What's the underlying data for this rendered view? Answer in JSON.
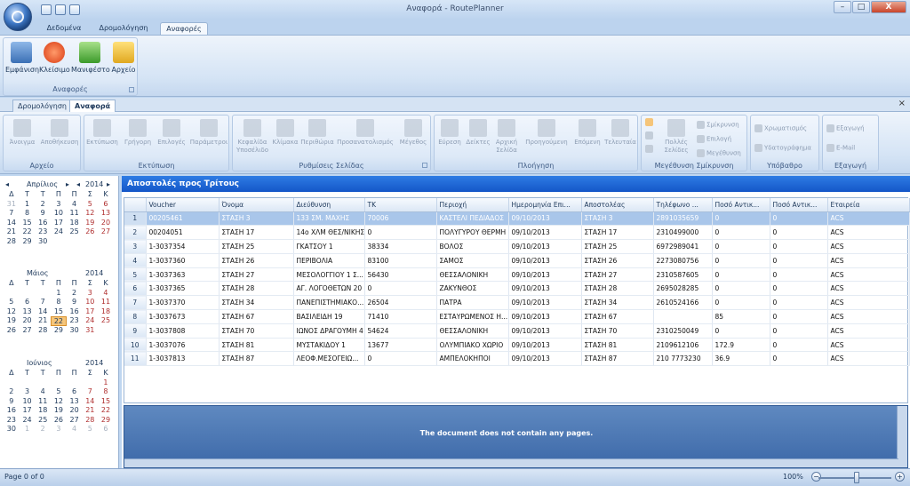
{
  "window": {
    "title": "Αναφορά - RoutePlanner",
    "controls": {
      "minimize": "–",
      "maximize": "□",
      "close": "X"
    }
  },
  "ribbon_tabs": [
    "Δεδομένα",
    "Δρομολόγηση",
    "Αναφορές"
  ],
  "reports_group": {
    "label": "Αναφορές",
    "buttons": [
      "Εμφάνιση",
      "Κλείσιμο",
      "Μανιφέστο",
      "Αρχείο"
    ]
  },
  "doc_tabs": [
    "Δρομολόγηση",
    "Αναφορά"
  ],
  "print_ribbon": {
    "groups": [
      {
        "label": "Αρχείο",
        "buttons": [
          "Άνοιγμα",
          "Αποθήκευση"
        ]
      },
      {
        "label": "Εκτύπωση",
        "buttons": [
          "Εκτύπωση",
          "Γρήγορη",
          "Επιλογές",
          "Παράμετροι"
        ]
      },
      {
        "label": "Ρυθμίσεις Σελίδας",
        "buttons": [
          "Κεφαλίδα Υποσέλιδο",
          "Κλίμακα",
          "Περιθώρια",
          "Προσανατολισμός",
          "Μέγεθος"
        ]
      },
      {
        "label": "Πλοήγηση",
        "buttons": [
          "Εύρεση",
          "Δείκτες",
          "Αρχική Σελίδα",
          "Προηγούμενη",
          "Επόμενη",
          "Τελευταία"
        ]
      },
      {
        "label": "Μεγέθυνση Σμίκρυνση",
        "buttons": [
          "Πολλές Σελίδες"
        ],
        "small": [
          "Σμίκρυνση",
          "Επιλογή",
          "Μεγέθυνση"
        ]
      },
      {
        "label": "Υπόβαθρο",
        "small": [
          "Χρωματισμός",
          "Υδατογράφημα"
        ]
      },
      {
        "label": "Εξαγωγή",
        "small": [
          "Εξαγωγή",
          "E-Mail"
        ]
      }
    ]
  },
  "calendar": {
    "dow": [
      "Δ",
      "Τ",
      "Τ",
      "Π",
      "Π",
      "Σ",
      "Κ"
    ],
    "months": [
      {
        "name": "Απρίλιος",
        "year": "2014",
        "days": [
          [
            "31",
            "dim"
          ],
          [
            "1",
            ""
          ],
          [
            "2",
            ""
          ],
          [
            "3",
            ""
          ],
          [
            "4",
            ""
          ],
          [
            "5",
            "wk"
          ],
          [
            "6",
            "wk"
          ],
          [
            "7",
            ""
          ],
          [
            "8",
            ""
          ],
          [
            "9",
            ""
          ],
          [
            "10",
            ""
          ],
          [
            "11",
            ""
          ],
          [
            "12",
            "wk"
          ],
          [
            "13",
            "wk"
          ],
          [
            "14",
            ""
          ],
          [
            "15",
            ""
          ],
          [
            "16",
            ""
          ],
          [
            "17",
            ""
          ],
          [
            "18",
            ""
          ],
          [
            "19",
            "wk"
          ],
          [
            "20",
            "wk"
          ],
          [
            "21",
            ""
          ],
          [
            "22",
            ""
          ],
          [
            "23",
            ""
          ],
          [
            "24",
            ""
          ],
          [
            "25",
            ""
          ],
          [
            "26",
            "wk"
          ],
          [
            "27",
            "wk"
          ],
          [
            "28",
            ""
          ],
          [
            "29",
            ""
          ],
          [
            "30",
            ""
          ]
        ]
      },
      {
        "name": "Μάιος",
        "year": "2014",
        "days": [
          [
            "",
            ""
          ],
          [
            "",
            ""
          ],
          [
            "",
            ""
          ],
          [
            "1",
            ""
          ],
          [
            "2",
            ""
          ],
          [
            "3",
            "wk"
          ],
          [
            "4",
            "wk"
          ],
          [
            "5",
            ""
          ],
          [
            "6",
            ""
          ],
          [
            "7",
            ""
          ],
          [
            "8",
            ""
          ],
          [
            "9",
            ""
          ],
          [
            "10",
            "wk"
          ],
          [
            "11",
            "wk"
          ],
          [
            "12",
            ""
          ],
          [
            "13",
            ""
          ],
          [
            "14",
            ""
          ],
          [
            "15",
            ""
          ],
          [
            "16",
            ""
          ],
          [
            "17",
            "wk"
          ],
          [
            "18",
            "wk"
          ],
          [
            "19",
            ""
          ],
          [
            "20",
            ""
          ],
          [
            "21",
            ""
          ],
          [
            "22",
            "today"
          ],
          [
            "23",
            ""
          ],
          [
            "24",
            "wk"
          ],
          [
            "25",
            "wk"
          ],
          [
            "26",
            ""
          ],
          [
            "27",
            ""
          ],
          [
            "28",
            ""
          ],
          [
            "29",
            ""
          ],
          [
            "30",
            ""
          ],
          [
            "31",
            "wk"
          ]
        ]
      },
      {
        "name": "Ιούνιος",
        "year": "2014",
        "days": [
          [
            "",
            ""
          ],
          [
            "",
            ""
          ],
          [
            "",
            ""
          ],
          [
            "",
            ""
          ],
          [
            "",
            ""
          ],
          [
            "",
            ""
          ],
          [
            "1",
            "wk"
          ],
          [
            "2",
            ""
          ],
          [
            "3",
            ""
          ],
          [
            "4",
            ""
          ],
          [
            "5",
            ""
          ],
          [
            "6",
            ""
          ],
          [
            "7",
            "wk"
          ],
          [
            "8",
            "wk"
          ],
          [
            "9",
            ""
          ],
          [
            "10",
            ""
          ],
          [
            "11",
            ""
          ],
          [
            "12",
            ""
          ],
          [
            "13",
            ""
          ],
          [
            "14",
            "wk"
          ],
          [
            "15",
            "wk"
          ],
          [
            "16",
            ""
          ],
          [
            "17",
            ""
          ],
          [
            "18",
            ""
          ],
          [
            "19",
            ""
          ],
          [
            "20",
            ""
          ],
          [
            "21",
            "wk"
          ],
          [
            "22",
            "wk"
          ],
          [
            "23",
            ""
          ],
          [
            "24",
            ""
          ],
          [
            "25",
            ""
          ],
          [
            "26",
            ""
          ],
          [
            "27",
            ""
          ],
          [
            "28",
            "wk"
          ],
          [
            "29",
            "wk"
          ],
          [
            "30",
            ""
          ],
          [
            "1",
            "dim"
          ],
          [
            "2",
            "dim"
          ],
          [
            "3",
            "dim"
          ],
          [
            "4",
            "dim"
          ],
          [
            "5",
            "dim"
          ],
          [
            "6",
            "dim"
          ]
        ]
      }
    ]
  },
  "grid": {
    "title": "Αποστολές προς Τρίτους",
    "columns": [
      "Voucher",
      "Όνομα",
      "Διεύθυνση",
      "ΤΚ",
      "Περιοχή",
      "Ημερομηνία Επι...",
      "Αποστολέας",
      "Τηλέφωνο ...",
      "Ποσό Αντικ...",
      "Ποσό Αντικ...",
      "Εταιρεία"
    ],
    "rows": [
      [
        "1",
        "00205461",
        "ΣΤΑΣΗ 3",
        "133 ΣΜ. ΜΑΧΗΣ",
        "70006",
        "ΚΑΣΤΕΛΙ ΠΕΔΙΑΔΟΣ",
        "09/10/2013",
        "ΣΤΑΣΗ 3",
        "2891035659",
        "0",
        "0",
        "ACS"
      ],
      [
        "2",
        "00204051",
        "ΣΤΑΣΗ 17",
        "14ο ΧΛΜ ΘΕΣ/ΝΙΚΗΣ",
        "0",
        "ΠΟΛΥΓΥΡΟΥ ΘΕΡΜΗ",
        "09/10/2013",
        "ΣΤΑΣΗ 17",
        "2310499000",
        "0",
        "0",
        "ACS"
      ],
      [
        "3",
        "1-3037354",
        "ΣΤΑΣΗ 25",
        "ΓΚΑΤΣΟΥ 1",
        "38334",
        "ΒΟΛΟΣ",
        "09/10/2013",
        "ΣΤΑΣΗ 25",
        "6972989041",
        "0",
        "0",
        "ACS"
      ],
      [
        "4",
        "1-3037360",
        "ΣΤΑΣΗ 26",
        "ΠΕΡΙΒΟΛΙΑ",
        "83100",
        "ΣΑΜΟΣ",
        "09/10/2013",
        "ΣΤΑΣΗ 26",
        "2273080756",
        "0",
        "0",
        "ACS"
      ],
      [
        "5",
        "1-3037363",
        "ΣΤΑΣΗ 27",
        "ΜΕΣΟΛΟΓΓΙΟΥ 1 Σ...",
        "56430",
        "ΘΕΣΣΑΛΟΝΙΚΗ",
        "09/10/2013",
        "ΣΤΑΣΗ 27",
        "2310587605",
        "0",
        "0",
        "ACS"
      ],
      [
        "6",
        "1-3037365",
        "ΣΤΑΣΗ 28",
        "ΑΓ. ΛΟΓΟΘΕΤΩΝ 20",
        "0",
        "ΖΑΚΥΝΘΟΣ",
        "09/10/2013",
        "ΣΤΑΣΗ 28",
        "2695028285",
        "0",
        "0",
        "ACS"
      ],
      [
        "7",
        "1-3037370",
        "ΣΤΑΣΗ 34",
        "ΠΑΝΕΠΙΣΤΗΜΙΑΚΟ...",
        "26504",
        "ΠΑΤΡΑ",
        "09/10/2013",
        "ΣΤΑΣΗ 34",
        "2610524166",
        "0",
        "0",
        "ACS"
      ],
      [
        "8",
        "1-3037673",
        "ΣΤΑΣΗ 67",
        "ΒΑΣΙΛΕΙΔΗ 19",
        "71410",
        "ΕΣΤΑΥΡΩΜΕΝΟΣ Η...",
        "09/10/2013",
        "ΣΤΑΣΗ 67",
        "",
        "85",
        "0",
        "ACS"
      ],
      [
        "9",
        "1-3037808",
        "ΣΤΑΣΗ 70",
        "ΙΩΝΟΣ ΔΡΑΓΟΥΜΗ 4",
        "54624",
        "ΘΕΣΣΑΛΟΝΙΚΗ",
        "09/10/2013",
        "ΣΤΑΣΗ 70",
        "2310250049",
        "0",
        "0",
        "ACS"
      ],
      [
        "10",
        "1-3037076",
        "ΣΤΑΣΗ 81",
        "ΜΥΣΤΑΚΙΔΟΥ 1",
        "13677",
        "ΟΛΥΜΠΙΑΚΟ ΧΩΡΙΟ",
        "09/10/2013",
        "ΣΤΑΣΗ 81",
        "2109612106",
        "172.9",
        "0",
        "ACS"
      ],
      [
        "11",
        "1-3037813",
        "ΣΤΑΣΗ 87",
        "ΛΕΟΦ.ΜΕΣΟΓΕΙΩ...",
        "0",
        "ΑΜΠΕΛΟΚΗΠΟΙ",
        "09/10/2013",
        "ΣΤΑΣΗ 87",
        "210 7773230",
        "36.9",
        "0",
        "ACS"
      ]
    ],
    "selected_row": 0
  },
  "preview": {
    "message": "The document does not contain any pages."
  },
  "status": {
    "page": "Page 0 of 0",
    "zoom": "100%",
    "zoom_minus": "−",
    "zoom_plus": "+"
  },
  "colors": {
    "accent": "#1456c8",
    "selection": "#a9c6ea",
    "today": "#f5c57a"
  }
}
